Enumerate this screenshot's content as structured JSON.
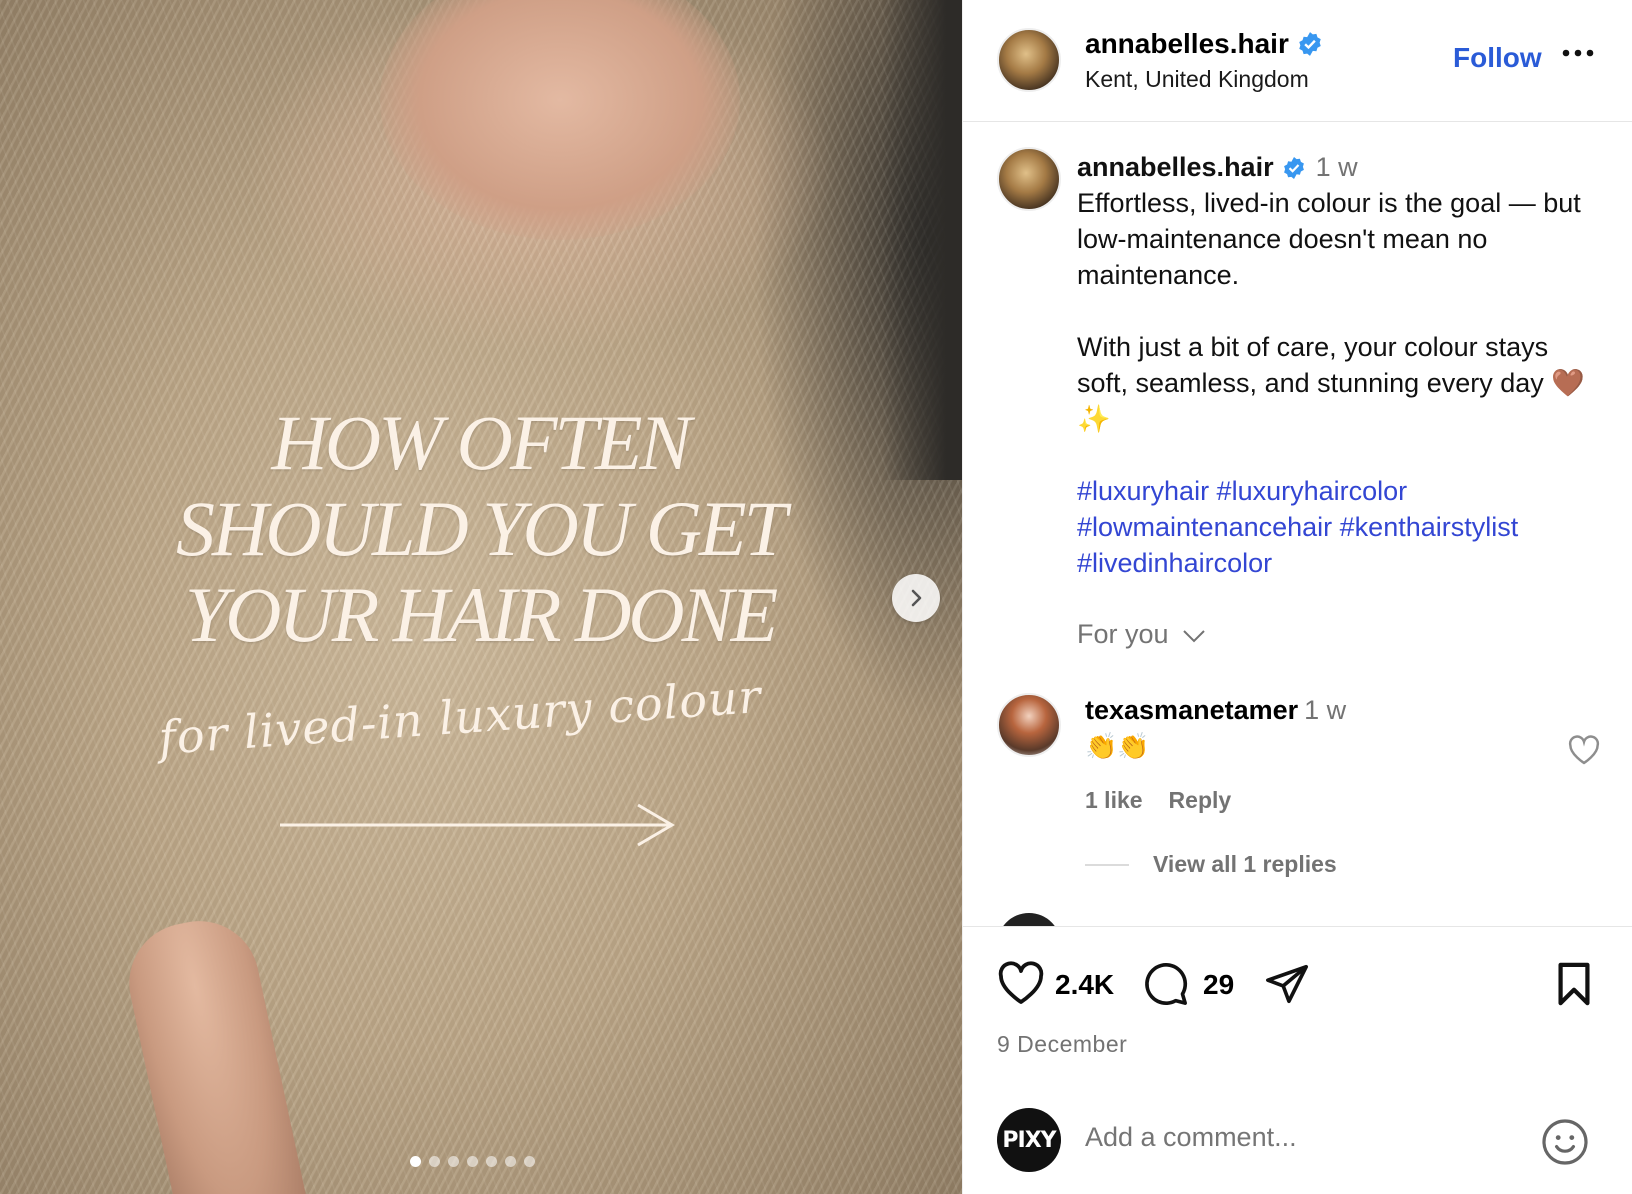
{
  "post": {
    "slide_headline": [
      "HOW OFTEN",
      "SHOULD YOU GET",
      "YOUR HAIR DONE"
    ],
    "slide_subline": "for lived-in luxury colour",
    "slide_count": 7,
    "active_slide": 1
  },
  "header": {
    "username": "annabelles.hair",
    "location": "Kent, United Kingdom",
    "follow_label": "Follow",
    "verified_icon": "verified-badge-icon",
    "more_icon": "more-options-icon"
  },
  "caption": {
    "username": "annabelles.hair",
    "time": "1 w",
    "paragraph1": "Effortless, lived-in colour is the goal — but low-maintenance doesn't mean no maintenance.",
    "paragraph2": "With just a bit of care, your colour stays soft, seamless, and stunning every day 🤎✨",
    "hashtags": "#luxuryhair #luxuryhaircolor #lowmaintenancehair #kenthairstylist #livedinhaircolor"
  },
  "filter": {
    "label": "For you"
  },
  "comments": [
    {
      "username": "texasmanetamer",
      "time": "1 w",
      "text": "👏👏",
      "likes_label": "1 like",
      "reply_label": "Reply",
      "view_replies_label": "View all 1 replies"
    }
  ],
  "actions": {
    "likes": "2.4K",
    "comments": "29",
    "date": "9 December"
  },
  "comment_box": {
    "avatar_text": "PIXY",
    "placeholder": "Add a comment..."
  },
  "colors": {
    "link_blue": "#3346d3",
    "follow_blue": "#2a5bd7",
    "verified_blue": "#3897f0",
    "muted_gray": "#737373"
  }
}
